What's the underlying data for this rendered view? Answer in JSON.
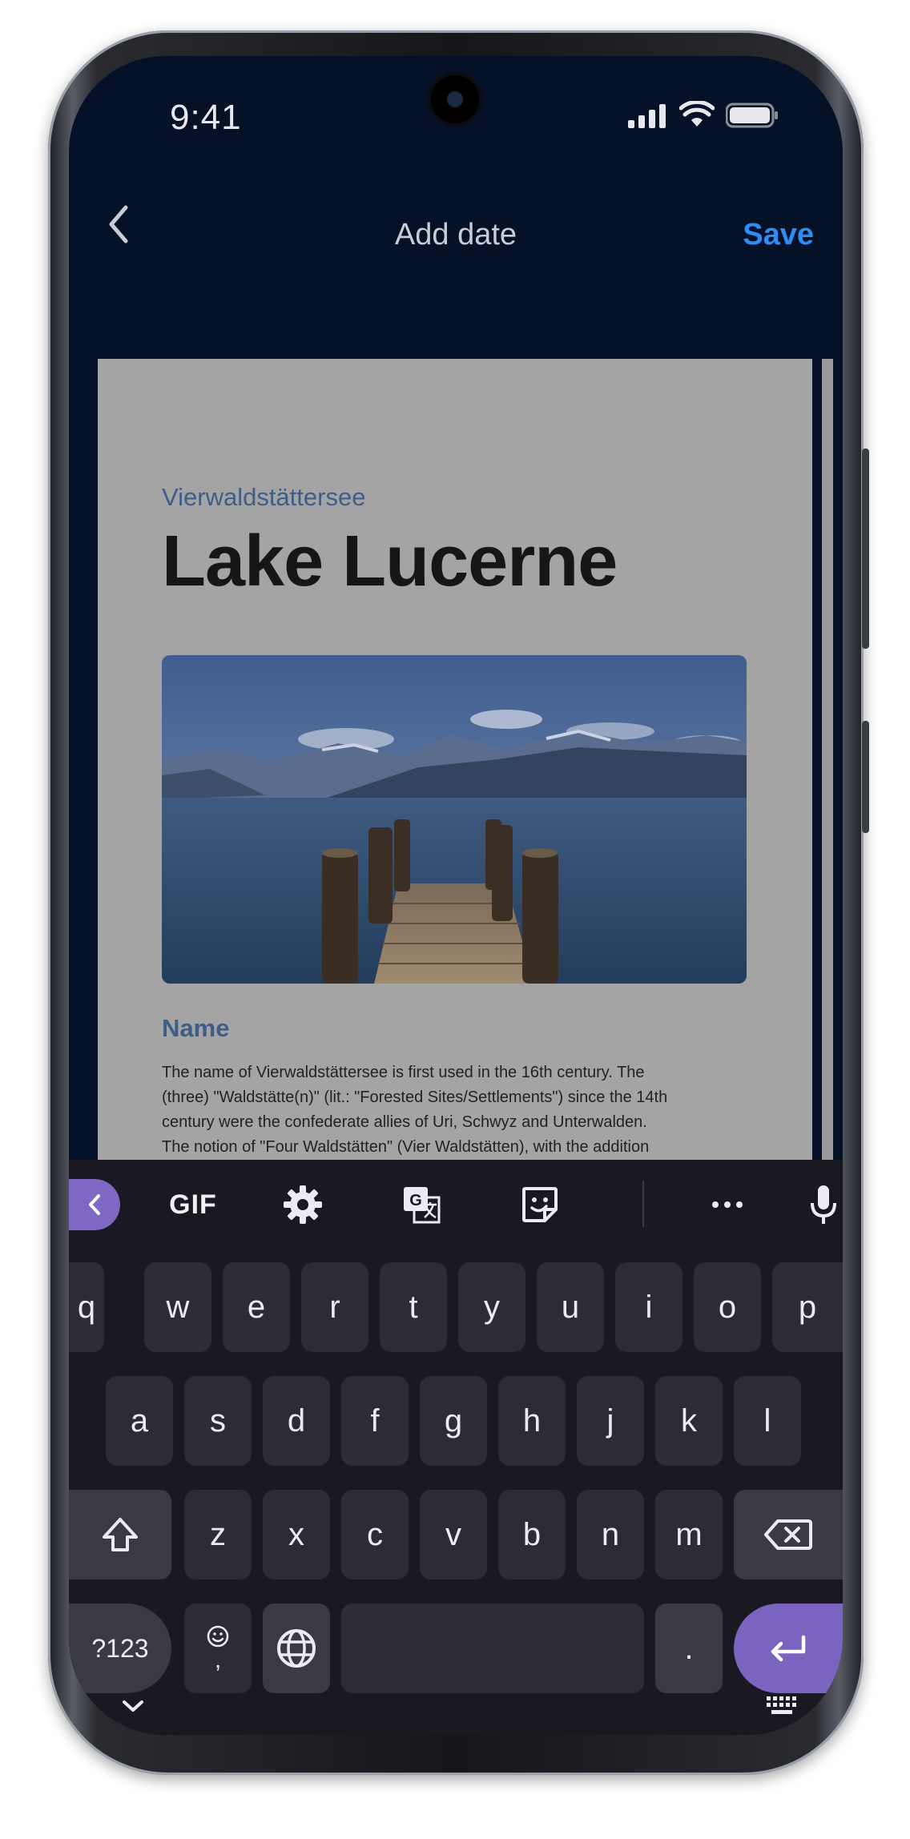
{
  "status_bar": {
    "time": "9:41"
  },
  "nav": {
    "title": "Add date",
    "save_label": "Save"
  },
  "document": {
    "kicker": "Vierwaldstättersee",
    "title": "Lake Lucerne",
    "section_heading": "Name",
    "body_lines": [
      "The name of Vierwaldstättersee is first used in the 16th century. The",
      "(three) \"Waldstätte(n)\" (lit.: \"Forested Sites/Settlements\") since the 14th",
      "century were the confederate allies of Uri, Schwyz and Unterwalden.",
      "The notion of \"Four Waldstätten\" (Vier Waldstätten), with the addition"
    ]
  },
  "keyboard": {
    "toolbar": {
      "gif_label": "GIF"
    },
    "row1": [
      "q",
      "w",
      "e",
      "r",
      "t",
      "y",
      "u",
      "i",
      "o",
      "p"
    ],
    "row2": [
      "a",
      "s",
      "d",
      "f",
      "g",
      "h",
      "j",
      "k",
      "l"
    ],
    "row3": [
      "z",
      "x",
      "c",
      "v",
      "b",
      "n",
      "m"
    ],
    "symbols_label": "?123",
    "emoji_comma_label": ",",
    "period_label": "."
  },
  "colors": {
    "accent": "#2f8cf5",
    "keyboard_accent": "#7b63c0",
    "nav_bg": "#051126"
  }
}
